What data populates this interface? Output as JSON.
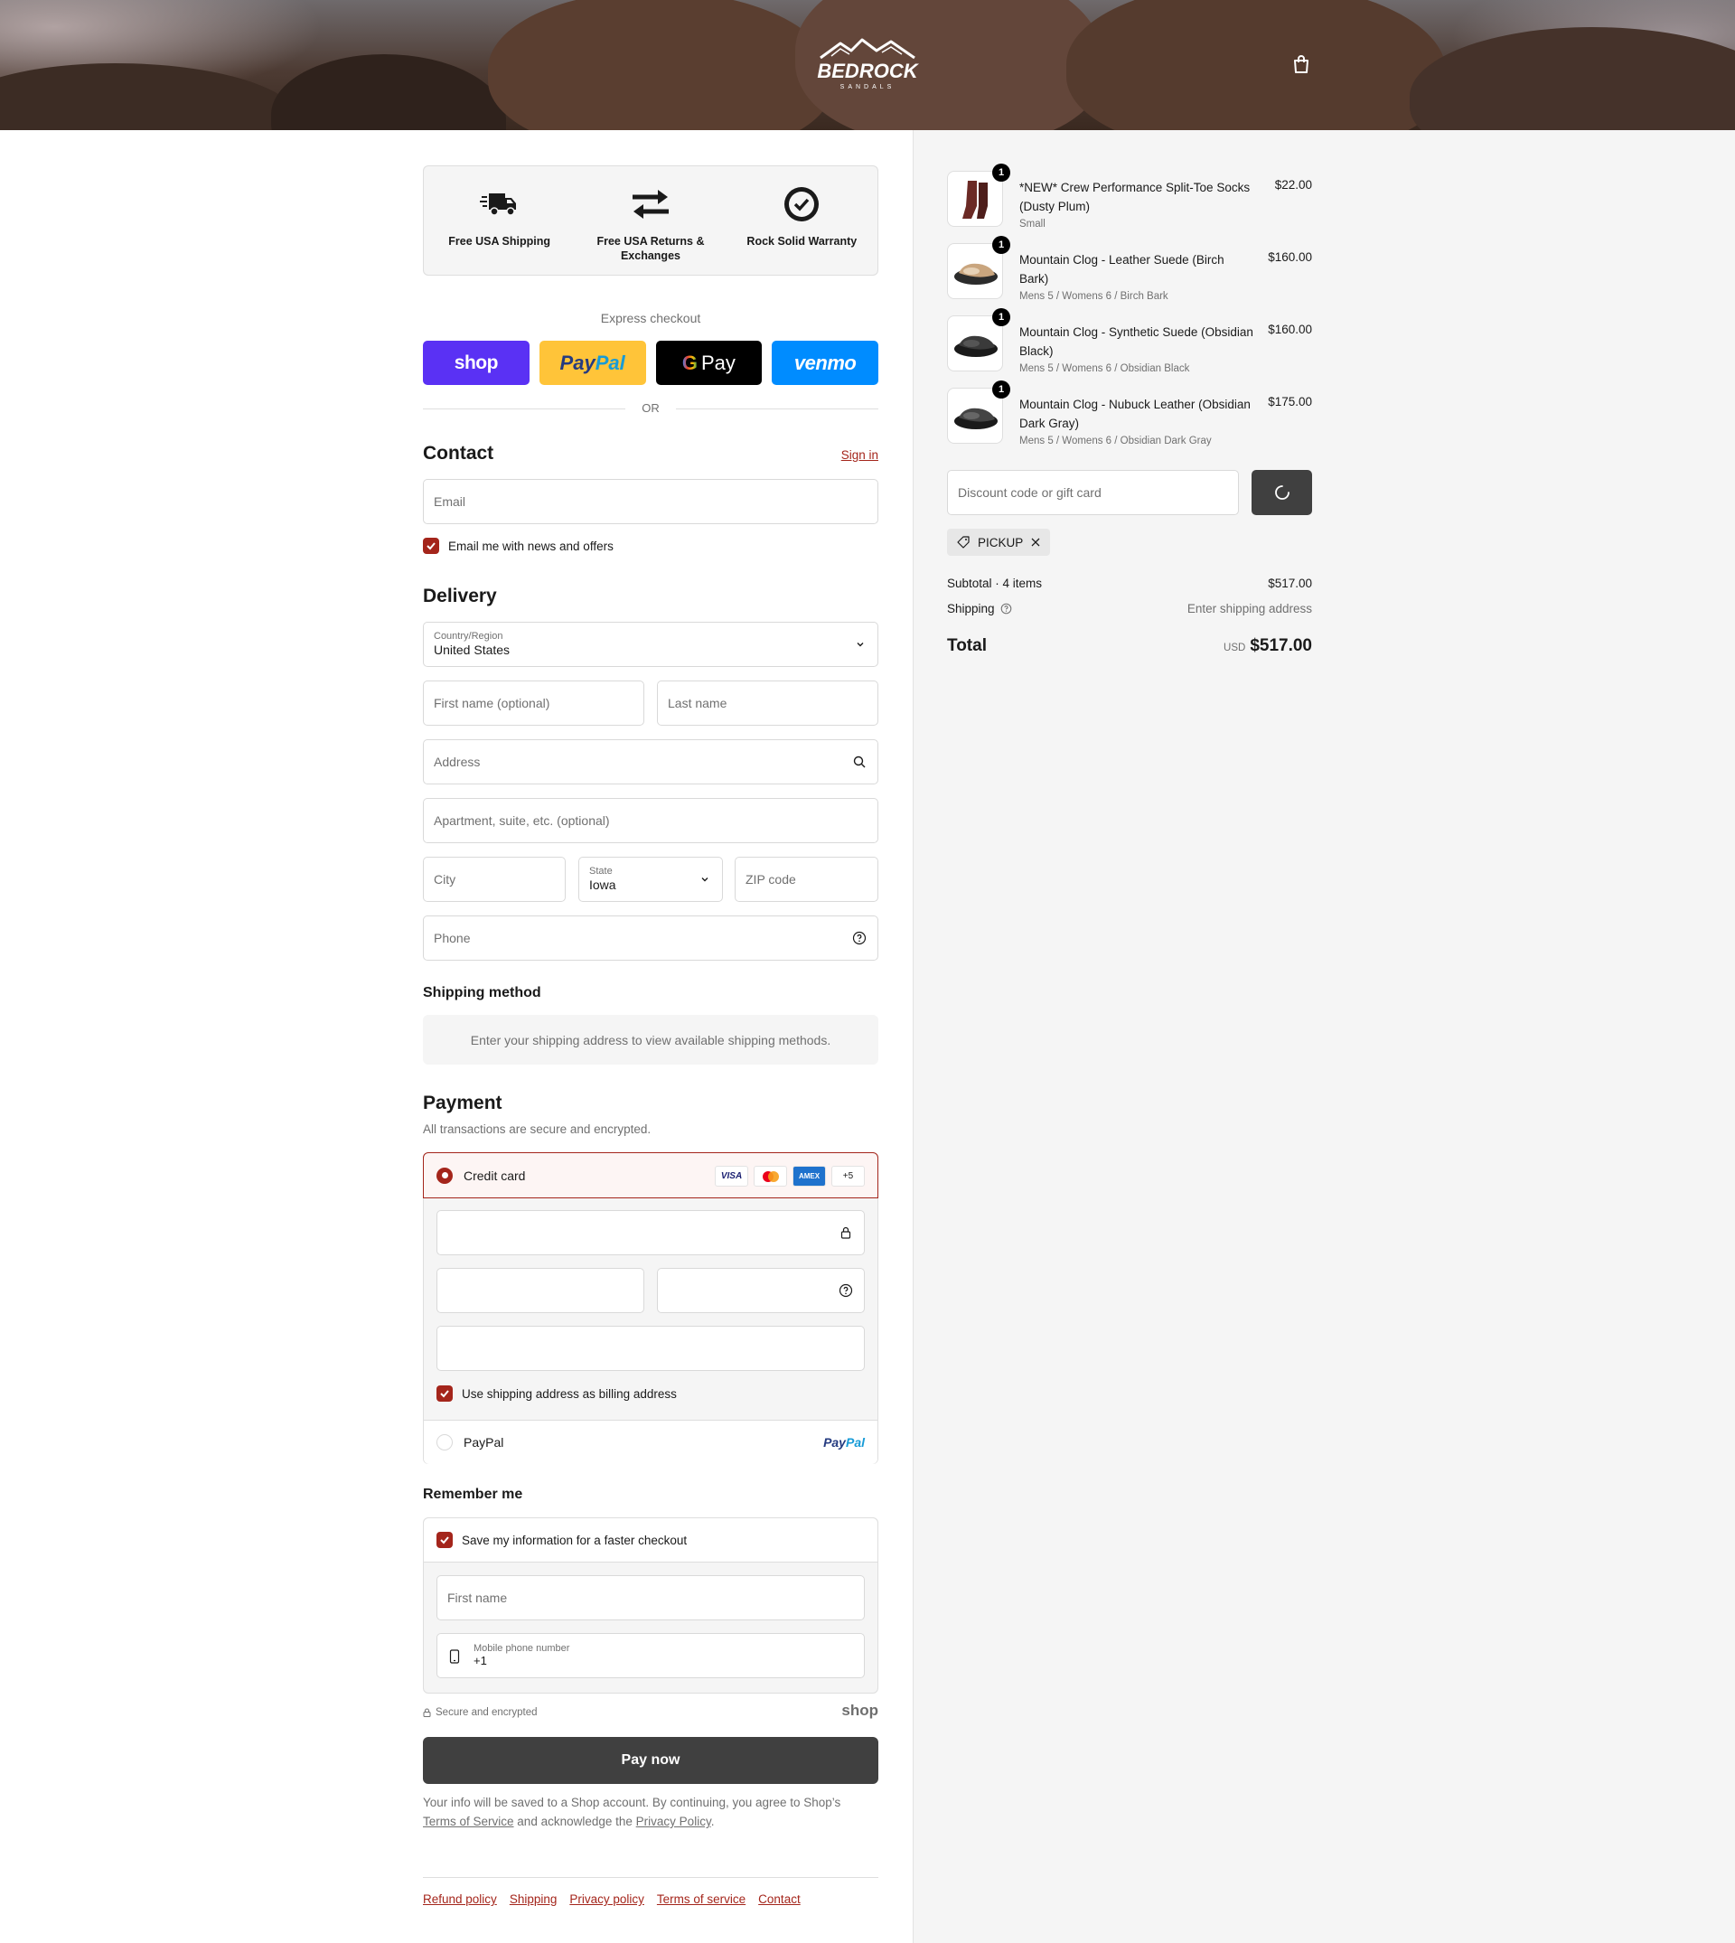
{
  "header": {
    "brand": "BEDROCK",
    "brand_sub": "SANDALS",
    "cart_icon": "cart-icon"
  },
  "features": [
    {
      "icon": "truck-icon",
      "label": "Free USA Shipping"
    },
    {
      "icon": "exchange-arrows-icon",
      "label": "Free USA Returns & Exchanges"
    },
    {
      "icon": "badge-check-icon",
      "label": "Rock Solid Warranty"
    }
  ],
  "express": {
    "label": "Express checkout",
    "buttons": {
      "shop": "shop",
      "paypal": "PayPal",
      "gpay": "Pay",
      "venmo": "venmo"
    },
    "or": "OR"
  },
  "contact": {
    "title": "Contact",
    "sign_in": "Sign in",
    "email_placeholder": "Email",
    "newsletter_label": "Email me with news and offers"
  },
  "delivery": {
    "title": "Delivery",
    "country_label": "Country/Region",
    "country_value": "United States",
    "first_name_placeholder": "First name (optional)",
    "last_name_placeholder": "Last name",
    "address_placeholder": "Address",
    "apartment_placeholder": "Apartment, suite, etc. (optional)",
    "city_placeholder": "City",
    "state_label": "State",
    "state_value": "Iowa",
    "zip_placeholder": "ZIP code",
    "phone_placeholder": "Phone"
  },
  "shipping_method": {
    "title": "Shipping method",
    "notice": "Enter your shipping address to view available shipping methods."
  },
  "payment": {
    "title": "Payment",
    "subtitle": "All transactions are secure and encrypted.",
    "credit_card_label": "Credit card",
    "brands": [
      "VISA",
      "",
      "AMEX",
      "+5"
    ],
    "billing_label": "Use shipping address as billing address",
    "paypal_label": "PayPal",
    "paypal_logo": "PayPal"
  },
  "remember": {
    "title": "Remember me",
    "save_label": "Save my information for a faster checkout",
    "first_name_placeholder": "First name",
    "mobile_label": "Mobile phone number",
    "mobile_value": "+1",
    "secure_label": "Secure and encrypted",
    "shop_logo": "shop"
  },
  "pay_now": "Pay now",
  "legal": {
    "text1": "Your info will be saved to a Shop account. By continuing, you agree to Shop’s",
    "tos": "Terms of Service",
    "text2": "and acknowledge the",
    "privacy": "Privacy Policy",
    "text3": "."
  },
  "footer_links": [
    "Refund policy",
    "Shipping",
    "Privacy policy",
    "Terms of service",
    "Contact"
  ],
  "order": {
    "items": [
      {
        "qty": "1",
        "name": "*NEW* Crew Performance Split-Toe Socks (Dusty Plum)",
        "variant": "Small",
        "price": "$22.00"
      },
      {
        "qty": "1",
        "name": "Mountain Clog - Leather Suede (Birch Bark)",
        "variant": "Mens 5 / Womens 6 / Birch Bark",
        "price": "$160.00"
      },
      {
        "qty": "1",
        "name": "Mountain Clog - Synthetic Suede (Obsidian Black)",
        "variant": "Mens 5 / Womens 6 / Obsidian Black",
        "price": "$160.00"
      },
      {
        "qty": "1",
        "name": "Mountain Clog - Nubuck Leather (Obsidian Dark Gray)",
        "variant": "Mens 5 / Womens 6 / Obsidian Dark Gray",
        "price": "$175.00"
      }
    ],
    "discount_placeholder": "Discount code or gift card",
    "applied_code": "PICKUP",
    "subtotal_label": "Subtotal · 4 items",
    "subtotal_value": "$517.00",
    "shipping_label": "Shipping",
    "shipping_value": "Enter shipping address",
    "total_label": "Total",
    "currency": "USD",
    "total_value": "$517.00"
  },
  "colors": {
    "accent": "#a4251b",
    "button": "#404040",
    "shop": "#5a31f4",
    "paypal": "#ffc439",
    "venmo": "#008cff"
  }
}
